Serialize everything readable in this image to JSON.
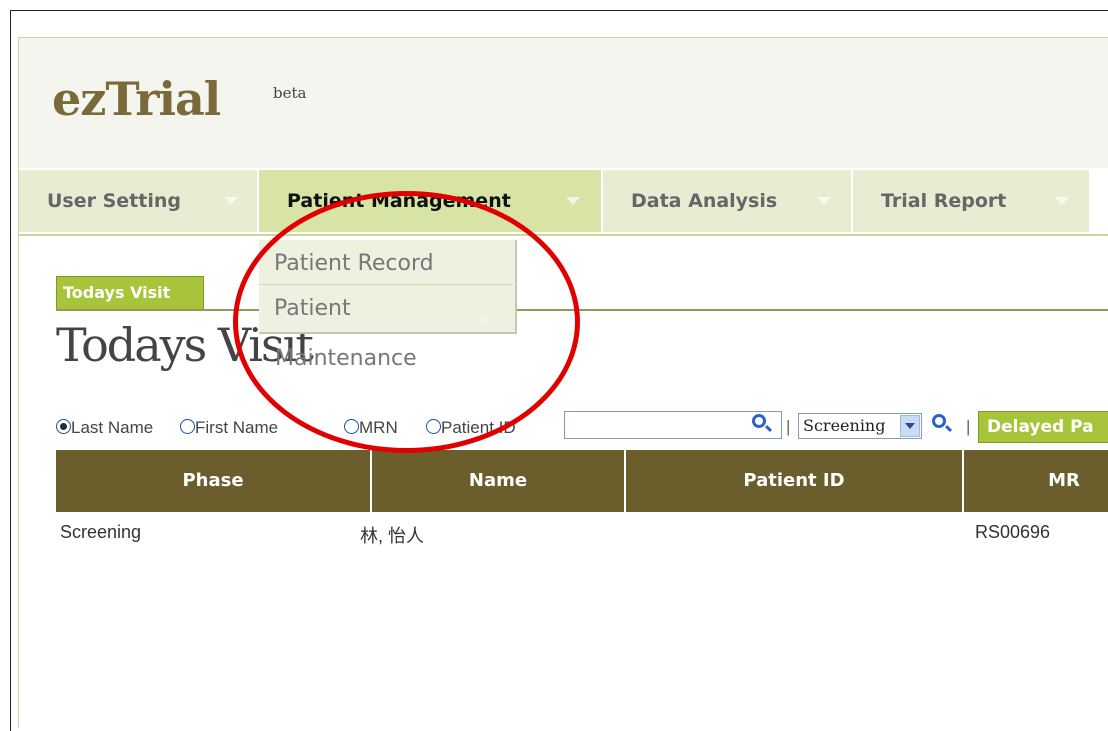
{
  "app": {
    "logo": "ezTrial",
    "logo_sup": "beta"
  },
  "nav": {
    "tabs": [
      {
        "label": "User Setting"
      },
      {
        "label": "Patient Management"
      },
      {
        "label": "Data Analysis"
      },
      {
        "label": "Trial Report"
      }
    ]
  },
  "dropdown": {
    "items": [
      {
        "label": "Patient Record"
      },
      {
        "label": "Patient"
      }
    ],
    "overflow_text": "Maintenance"
  },
  "visit_tab": {
    "label": "Todays Visit"
  },
  "page_title": "Todays Visit",
  "search": {
    "options": [
      {
        "label": "Last Name",
        "checked": true
      },
      {
        "label": "First Name",
        "checked": false
      },
      {
        "label": "MRN",
        "checked": false
      },
      {
        "label": "Patient ID",
        "checked": false
      }
    ],
    "input_value": "",
    "select_value": "Screening",
    "delayed_button": "Delayed Pa"
  },
  "table": {
    "columns": [
      "Phase",
      "Name",
      "Patient ID",
      "MR"
    ],
    "rows": [
      {
        "phase": "Screening",
        "name": "林, 怡人",
        "patient_id": "",
        "mrn": "RS00696"
      }
    ]
  },
  "colors": {
    "accent_green": "#a8c43a",
    "header_brown": "#6b5e2c",
    "annotation_red": "#e00000"
  }
}
